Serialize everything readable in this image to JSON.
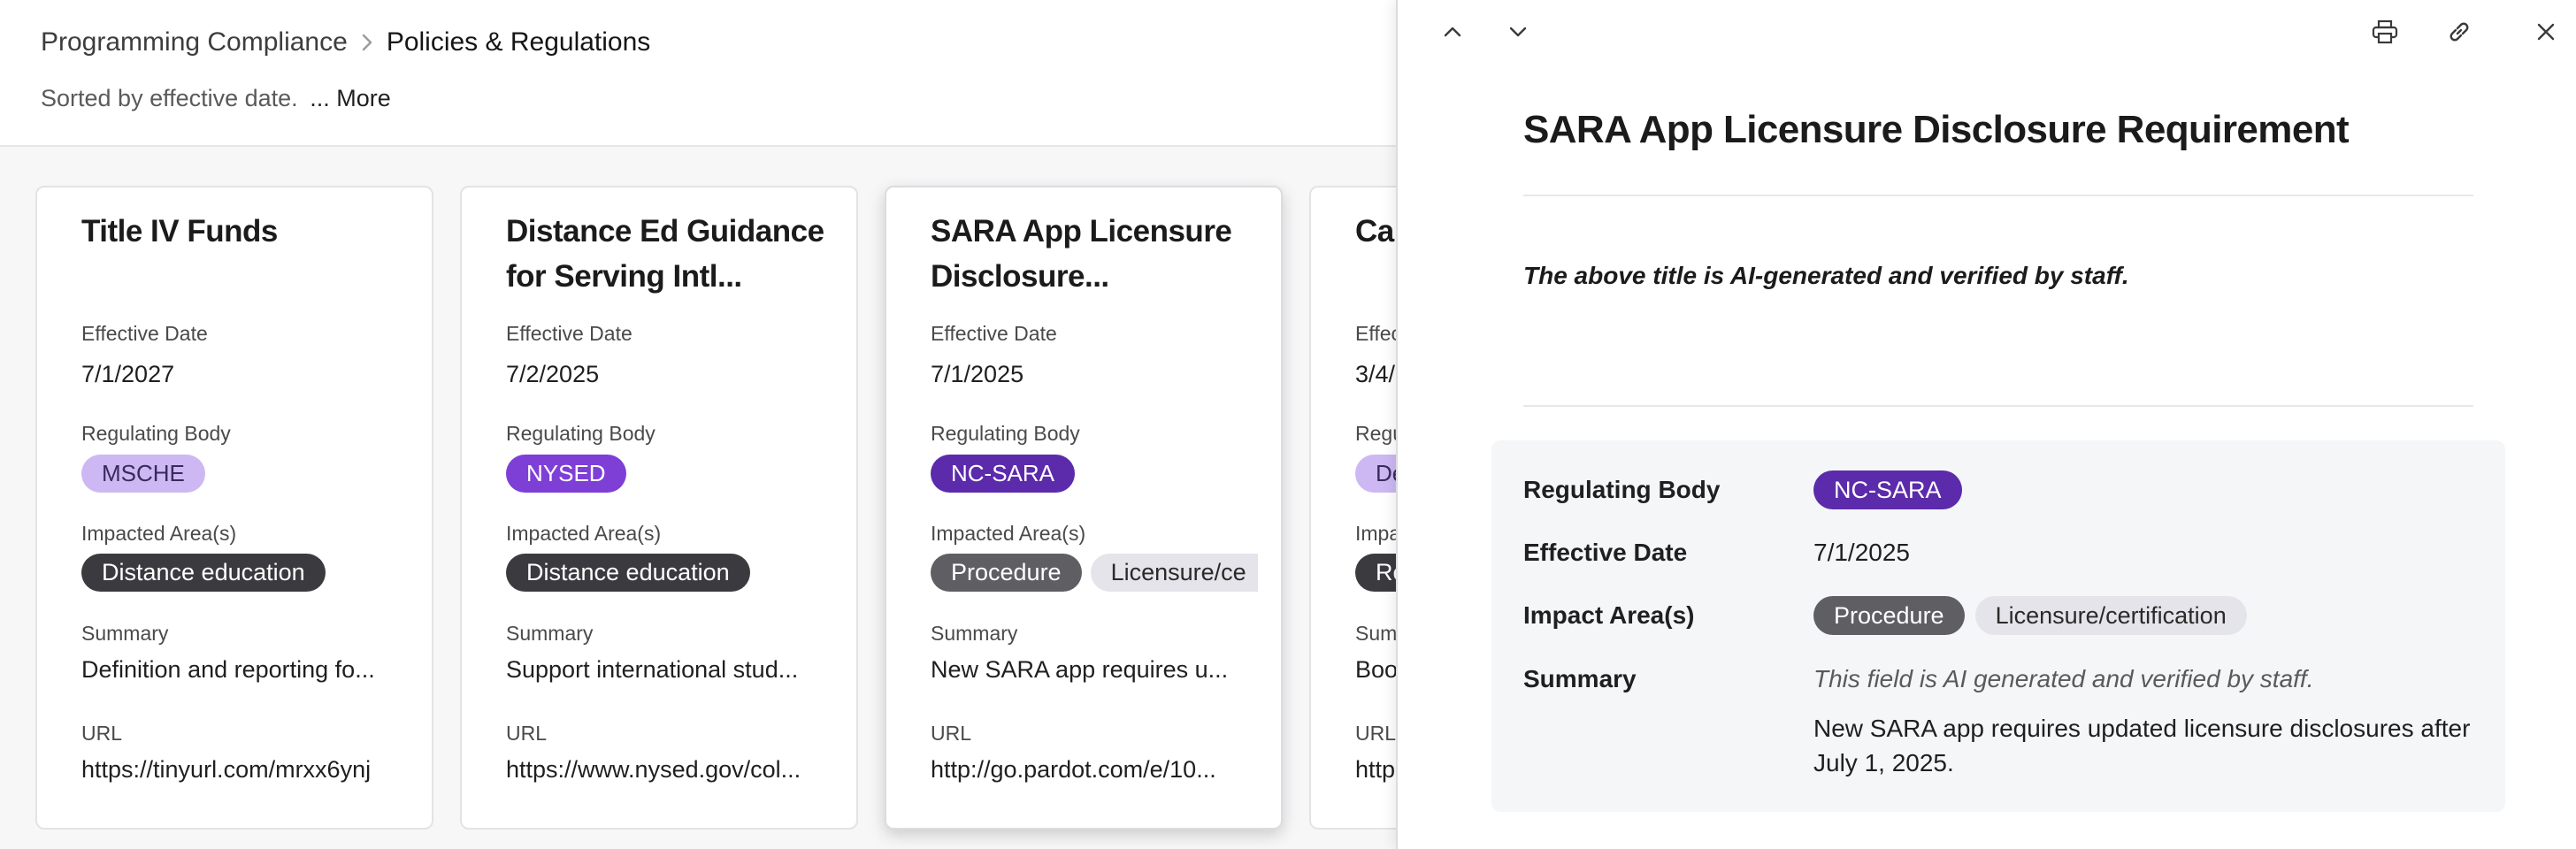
{
  "breadcrumb": {
    "root": "Programming Compliance",
    "current": "Policies & Regulations"
  },
  "sort": {
    "text": "Sorted by effective date.",
    "more": "... More"
  },
  "field_labels": {
    "effective_date": "Effective Date",
    "regulating_body": "Regulating Body",
    "impacted_areas": "Impacted Area(s)",
    "summary": "Summary",
    "url": "URL"
  },
  "cards": [
    {
      "title": "Title IV Funds",
      "effective_date": "7/1/2027",
      "regulating_body": "MSCHE",
      "impacted_areas": [
        "Distance education"
      ],
      "summary": "Definition and reporting fo...",
      "url": "https://tinyurl.com/mrxx6ynj"
    },
    {
      "title": "Distance Ed Guidance for Serving Intl...",
      "effective_date": "7/2/2025",
      "regulating_body": "NYSED",
      "impacted_areas": [
        "Distance education"
      ],
      "summary": "Support international stud...",
      "url": "https://www.nysed.gov/col..."
    },
    {
      "title": "SARA App Licensure Disclosure...",
      "effective_date": "7/1/2025",
      "regulating_body": "NC-SARA",
      "impacted_areas": [
        "Procedure",
        "Licensure/ce"
      ],
      "summary": "New SARA app requires u...",
      "url": "http://go.pardot.com/e/10..."
    },
    {
      "title": "Ca",
      "effective_date": "3/4/",
      "regulating_body": "De",
      "impacted_areas": [
        "Re"
      ],
      "summary": "Boo",
      "url": "http"
    }
  ],
  "card_labels_partial": {
    "effective_date": "Effec",
    "regulating_body": "Regu",
    "impacted_areas": "Impa",
    "summary": "Sum",
    "url": "URL"
  },
  "detail": {
    "title": "SARA App Licensure Disclosure Requirement",
    "ai_note": "The above title is AI-generated and verified by staff.",
    "labels": {
      "regulating_body": "Regulating Body",
      "effective_date": "Effective Date",
      "impact_areas": "Impact Area(s)",
      "summary": "Summary"
    },
    "regulating_body": "NC-SARA",
    "effective_date": "7/1/2025",
    "impact_areas": [
      "Procedure",
      "Licensure/certification"
    ],
    "summary_ai_tag": "This field is AI generated and verified by staff.",
    "summary": "New SARA app requires updated licensure disclosures after July 1, 2025.",
    "toolbar_icons": [
      "chevron-up-icon",
      "chevron-down-icon",
      "print-icon",
      "link-icon",
      "close-icon"
    ]
  },
  "colors": {
    "msche": "#cdb8f3",
    "nysed": "#7e3fd6",
    "nc_sara": "#5b2bab",
    "dark_chip": "#3b3b3f",
    "grey_chip": "#5f5f63",
    "light_chip": "#e4e4ea"
  }
}
